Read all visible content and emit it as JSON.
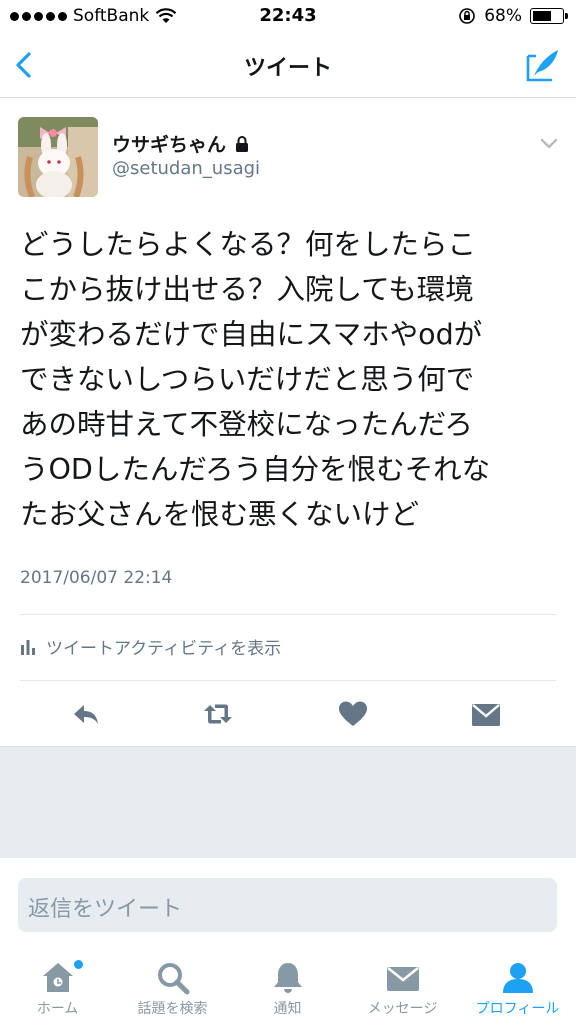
{
  "status_bar": {
    "carrier": "SoftBank",
    "time": "22:43",
    "battery_percent": "68%",
    "battery_level": 0.68
  },
  "nav": {
    "title": "ツイート",
    "back_icon": "chevron-left-icon",
    "compose_icon": "compose-tweet-icon"
  },
  "tweet": {
    "display_name": "ウサギちゃん",
    "handle": "@setudan_usagi",
    "protected": true,
    "text": "どうしたらよくなる？何をしたらこ\nこから抜け出せる？入院しても環境\nが変わるだけで自由にスマホやodが\nできないしつらいだけだと思う何で\nあの時甘えて不登校になったんだろ\nうODしたんだろう自分を恨むそれな\nたお父さんを恨む悪くないけど",
    "timestamp": "2017/06/07 22:14",
    "activity_label": "ツイートアクティビティを表示"
  },
  "actions": [
    {
      "name": "reply-icon"
    },
    {
      "name": "retweet-icon"
    },
    {
      "name": "like-icon"
    },
    {
      "name": "direct-message-icon"
    }
  ],
  "reply": {
    "placeholder": "返信をツイート"
  },
  "tabs": [
    {
      "label": "ホーム",
      "icon": "home-icon",
      "active": false,
      "has_badge": true
    },
    {
      "label": "話題を検索",
      "icon": "search-icon",
      "active": false
    },
    {
      "label": "通知",
      "icon": "bell-icon",
      "active": false
    },
    {
      "label": "メッセージ",
      "icon": "envelope-icon",
      "active": false
    },
    {
      "label": "プロフィール",
      "icon": "profile-icon",
      "active": true
    }
  ],
  "colors": {
    "accent": "#1da1f2",
    "secondary_text": "#657786",
    "icon_gray": "#8899a6",
    "background_gray": "#e6ecf0"
  }
}
